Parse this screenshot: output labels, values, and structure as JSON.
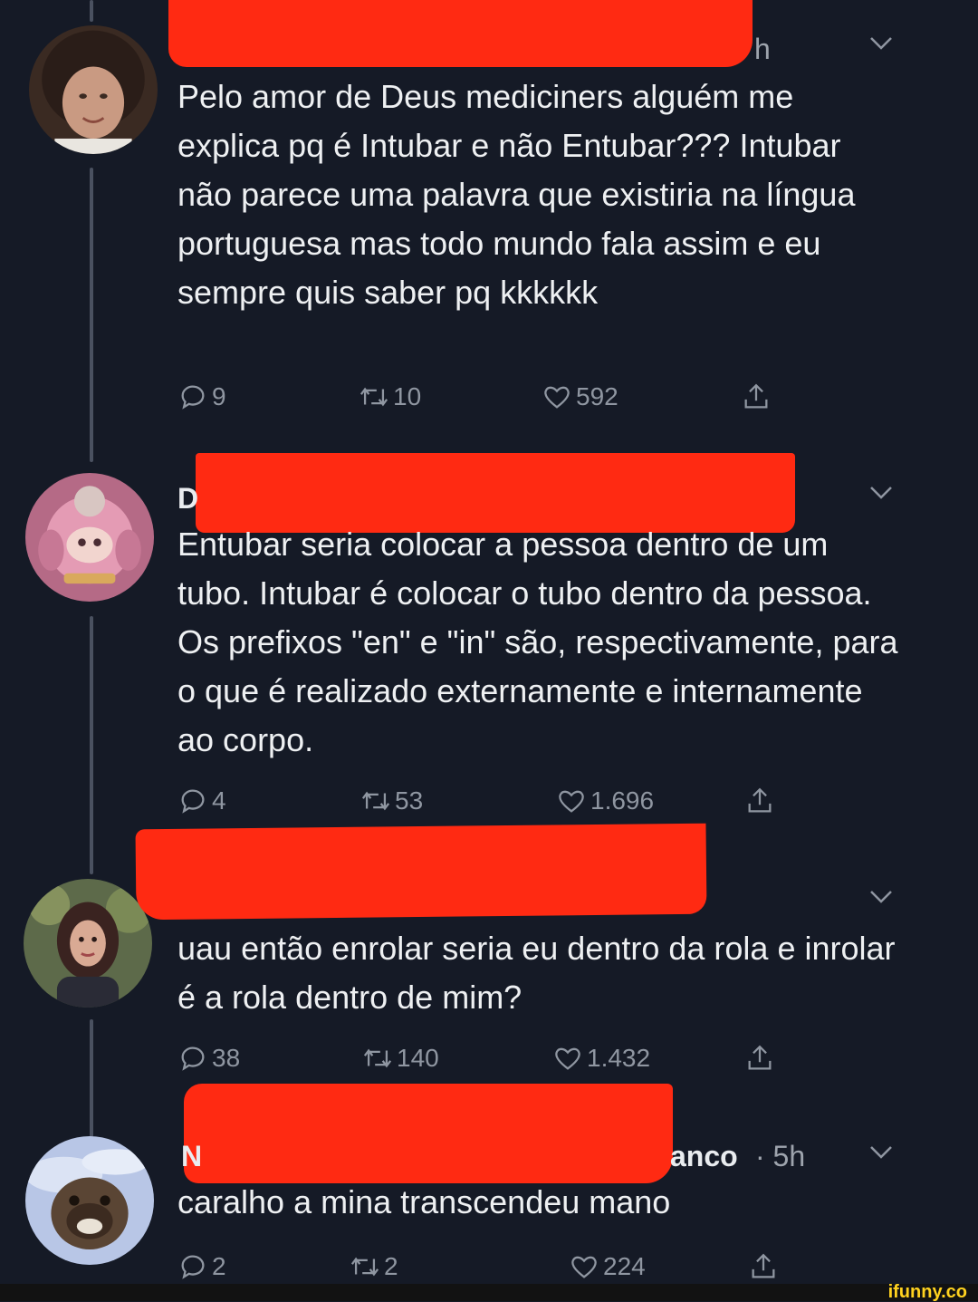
{
  "tweets": [
    {
      "name_visible": "",
      "time_visible": "h",
      "text": "Pelo amor de Deus mediciners alguém me explica pq é Intubar e não Entubar??? Intubar não parece uma palavra que existiria na língua portuguesa mas todo mundo fala assim e eu sempre quis saber pq kkkkkk",
      "replies": "9",
      "retweets": "10",
      "likes": "592"
    },
    {
      "name_visible": "D",
      "time_visible": "",
      "text": "Entubar seria colocar a pessoa dentro de um tubo. Intubar é colocar o tubo dentro da pessoa. Os prefixos \"en\" e \"in\" são, respectivamente, para o que é realizado externamente e internamente ao corpo.",
      "replies": "4",
      "retweets": "53",
      "likes": "1.696"
    },
    {
      "name_visible": "",
      "time_visible": "",
      "text": "uau então enrolar seria eu dentro da rola e inrolar é a rola dentro de mim?",
      "replies": "38",
      "retweets": "140",
      "likes": "1.432"
    },
    {
      "name_visible": "N",
      "name_suffix": "anco",
      "time_visible": "· 5h",
      "text": "caralho a mina transcendeu mano",
      "replies": "2",
      "retweets": "2",
      "likes": "224"
    }
  ],
  "icons": {
    "reply": "reply-icon",
    "retweet": "retweet-icon",
    "like": "heart-icon",
    "share": "share-icon",
    "more": "chevron-down-icon"
  },
  "colors": {
    "background": "#151a26",
    "redaction": "#ff2a12",
    "watermark": "#ffd21f"
  },
  "watermark": "ifunny.co"
}
